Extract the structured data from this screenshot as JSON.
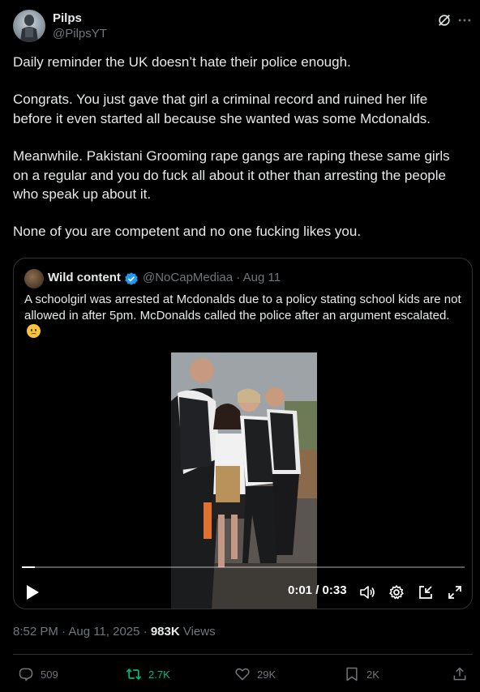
{
  "author": {
    "name": "Pilps",
    "handle": "@PilpsYT"
  },
  "tweet": {
    "paragraphs": [
      "Daily reminder the UK doesn’t hate their police enough.",
      "Congrats. You just gave that girl a criminal record and ruined her life before it even started all because she wanted was some Mcdonalds.",
      "Meanwhile. Pakistani Grooming rape gangs are raping these same girls on a regular and you do fuck all about it other than arresting the people who speak up about it.",
      "None of you are competent and no one fucking likes you."
    ]
  },
  "quote": {
    "name": "Wild content",
    "handle_date": "@NoCapMediaa · Aug 11",
    "text": "A schoolgirl was arrested at Mcdonalds due to a policy stating school kids are not allowed in after 5pm. McDonalds called the police after an argument escalated.",
    "video": {
      "time": "0:01 / 0:33",
      "progress": 0.03
    }
  },
  "meta": {
    "timestamp": "8:52 PM · Aug 11, 2025 · ",
    "views_count": "983K",
    "views_label": " Views"
  },
  "actions": {
    "replies": "509",
    "retweets": "2.7K",
    "likes": "29K",
    "bookmarks": "2K"
  },
  "colors": {
    "background": "#000000",
    "text": "#e7e9ea",
    "muted": "#71767b",
    "retweet": "#00ba7c",
    "verified": "#1d9bf0",
    "border": "#2f3336"
  }
}
